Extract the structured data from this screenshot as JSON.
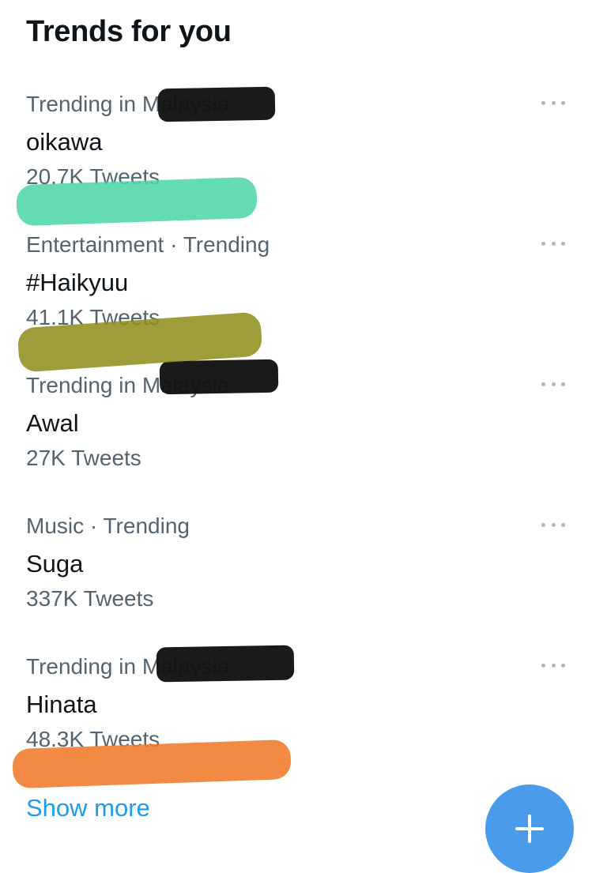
{
  "header": {
    "title": "Trends for you"
  },
  "trends": [
    {
      "meta": "Trending in Malaysia",
      "name": "oikawa",
      "count": "20.7K Tweets",
      "redacted": true,
      "highlight_color": "#4fd6a8"
    },
    {
      "meta": "Entertainment · Trending",
      "name": "#Haikyuu",
      "count": "41.1K Tweets",
      "redacted": false,
      "highlight_color": "#8f8f1f"
    },
    {
      "meta": "Trending in Malaysia",
      "name": "Awal",
      "count": "27K Tweets",
      "redacted": true,
      "highlight_color": ""
    },
    {
      "meta": "Music · Trending",
      "name": "Suga",
      "count": "337K Tweets",
      "redacted": false,
      "highlight_color": ""
    },
    {
      "meta": "Trending in Malaysia",
      "name": "Hinata",
      "count": "48.3K Tweets",
      "redacted": true,
      "highlight_color": "#f07a2a"
    }
  ],
  "footer": {
    "show_more_label": "Show more"
  },
  "colors": {
    "text": "#0f1419",
    "secondary_text": "#536471",
    "link": "#1d9bf0",
    "fab": "#4a9bea"
  },
  "icons": {
    "more": "more-horizontal-icon",
    "compose": "plus-icon"
  }
}
